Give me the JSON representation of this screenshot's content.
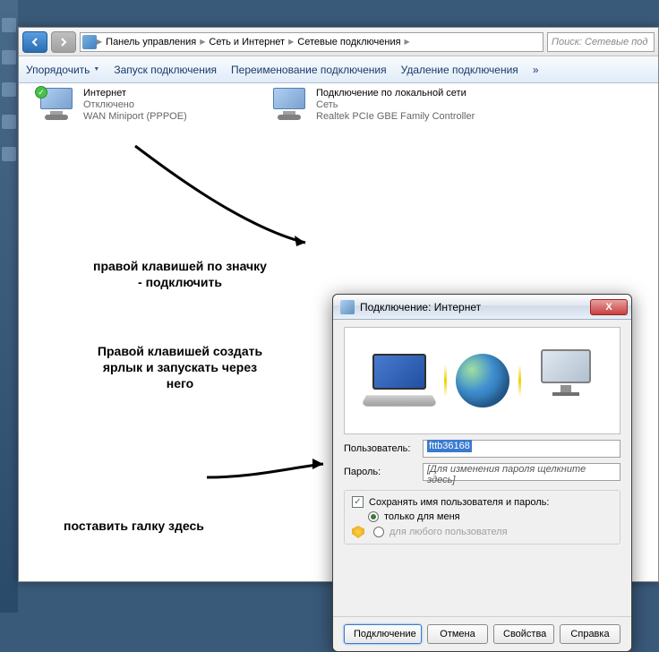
{
  "breadcrumb": {
    "items": [
      "Панель управления",
      "Сеть и Интернет",
      "Сетевые подключения"
    ]
  },
  "search": {
    "placeholder": "Поиск: Сетевые под"
  },
  "toolbar": {
    "organize": "Упорядочить",
    "start": "Запуск подключения",
    "rename": "Переименование подключения",
    "delete": "Удаление подключения",
    "more": "»"
  },
  "connections": [
    {
      "name": "Интернет",
      "status": "Отключено",
      "device": "WAN Miniport (PPPOE)"
    },
    {
      "name": "Подключение по локальной сети",
      "status": "Сеть",
      "device": "Realtek PCIe GBE Family Controller"
    }
  ],
  "annotations": {
    "a1": "правой клавишей по значку - подключить",
    "a2": "Правой клавишей создать ярлык и запускать через него",
    "a3": "поставить галку здесь"
  },
  "dialog": {
    "title": "Подключение: Интернет",
    "close": "X",
    "user_label": "Пользователь:",
    "user_value": "fttb36168",
    "pass_label": "Пароль:",
    "pass_placeholder": "[Для изменения пароля щелкните здесь]",
    "save_credentials": "Сохранять имя пользователя и пароль:",
    "only_me": "только для меня",
    "any_user": "для любого пользователя",
    "btn_connect": "Подключение",
    "btn_cancel": "Отмена",
    "btn_props": "Свойства",
    "btn_help": "Справка"
  }
}
